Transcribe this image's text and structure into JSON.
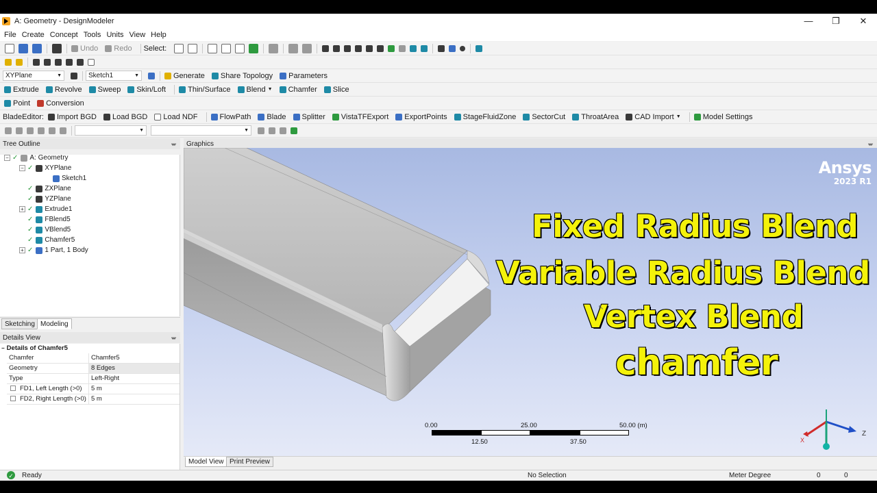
{
  "window": {
    "title": "A: Geometry - DesignModeler",
    "minimize": "—",
    "restore": "❐",
    "close": "✕"
  },
  "menu": [
    "File",
    "Create",
    "Concept",
    "Tools",
    "Units",
    "View",
    "Help"
  ],
  "toolbar1": {
    "undo": "Undo",
    "redo": "Redo",
    "select_label": "Select:"
  },
  "toolbar3": {
    "plane_combo": "XYPlane",
    "sketch_combo": "Sketch1",
    "generate": "Generate",
    "share_topology": "Share Topology",
    "parameters": "Parameters"
  },
  "toolbar4": [
    "Extrude",
    "Revolve",
    "Sweep",
    "Skin/Loft",
    "Thin/Surface",
    "Blend",
    "Chamfer",
    "Slice"
  ],
  "toolbar5": [
    "Point",
    "Conversion"
  ],
  "toolbar6": {
    "blade_editor": "BladeEditor:",
    "items": [
      "Import BGD",
      "Load BGD",
      "Load NDF",
      "FlowPath",
      "Blade",
      "Splitter",
      "VistaTFExport",
      "ExportPoints",
      "StageFluidZone",
      "SectorCut",
      "ThroatArea",
      "CAD Import",
      "Model Settings"
    ]
  },
  "tree_outline": {
    "header": "Tree Outline",
    "pin": "ᚚ",
    "root": "A: Geometry",
    "items": [
      "XYPlane",
      "Sketch1",
      "ZXPlane",
      "YZPlane",
      "Extrude1",
      "FBlend5",
      "VBlend5",
      "Chamfer5",
      "1 Part, 1 Body"
    ]
  },
  "tabs": [
    "Sketching",
    "Modeling"
  ],
  "details": {
    "header": "Details View",
    "title": "Details of Chamfer5",
    "rows": [
      {
        "k": "Chamfer",
        "v": "Chamfer5"
      },
      {
        "k": "Geometry",
        "v": "8 Edges"
      },
      {
        "k": "Type",
        "v": "Left-Right"
      },
      {
        "k": "FD1,  Left Length (>0)",
        "v": "5 m"
      },
      {
        "k": "FD2,  Right Length (>0)",
        "v": "5 m"
      }
    ]
  },
  "graphics": {
    "header": "Graphics",
    "brand": "Ansys",
    "version": "2023 R1",
    "overlay": [
      "Fixed Radius Blend",
      "Variable Radius Blend",
      "Vertex Blend",
      "chamfer"
    ],
    "scale_labels": [
      "0.00",
      "25.00",
      "50.00 (m)",
      "12.50",
      "37.50"
    ],
    "axis_x": "X",
    "axis_z": "Z"
  },
  "graphics_tabs": [
    "Model View",
    "Print Preview"
  ],
  "status": {
    "ready": "Ready",
    "selection": "No Selection",
    "units": "Meter  Degree",
    "v1": "0",
    "v2": "0"
  },
  "colors": {
    "overlay_text": "#f4f20a",
    "background_top": "#a8b9e2",
    "accent_green": "#2e9a3f"
  }
}
